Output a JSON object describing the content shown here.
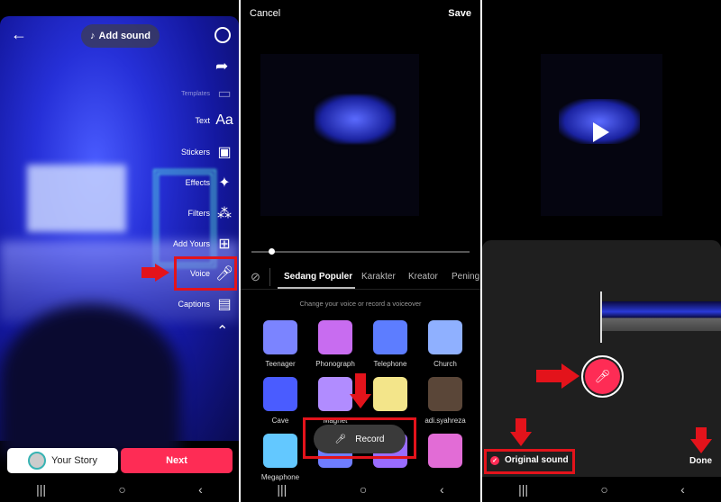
{
  "panel1": {
    "back_icon": "arrow-left",
    "add_sound": "Add sound",
    "tools": [
      {
        "label": "",
        "icon": "settings-gear"
      },
      {
        "label": "",
        "icon": "share-arrow"
      },
      {
        "label": "Templates",
        "icon": "template"
      },
      {
        "label": "Text",
        "icon": "Aa"
      },
      {
        "label": "Stickers",
        "icon": "sticker"
      },
      {
        "label": "Effects",
        "icon": "sparkle"
      },
      {
        "label": "Filters",
        "icon": "filters"
      },
      {
        "label": "Add Yours",
        "icon": "add-yours"
      },
      {
        "label": "Voice",
        "icon": "voice-mic"
      },
      {
        "label": "Captions",
        "icon": "captions"
      },
      {
        "label": "",
        "icon": "chevron-up"
      }
    ],
    "your_story": "Your Story",
    "next": "Next"
  },
  "panel2": {
    "cancel": "Cancel",
    "save": "Save",
    "tabs": [
      "Sedang Populer",
      "Karakter",
      "Kreator",
      "Pening"
    ],
    "subtitle": "Change your voice or record a voiceover",
    "effects": [
      {
        "label": "Teenager",
        "color": "#7b84ff"
      },
      {
        "label": "Phonograph",
        "color": "#c86cf0"
      },
      {
        "label": "Telephone",
        "color": "#5d7dff"
      },
      {
        "label": "Church",
        "color": "#8fb0ff"
      },
      {
        "label": "Cave",
        "color": "#4a5cff"
      },
      {
        "label": "Magnet",
        "color": "#b18cff"
      },
      {
        "label": "",
        "color": "#f3e58a"
      },
      {
        "label": "adi.syahreza",
        "color": "#5a4638"
      },
      {
        "label": "Megaphone",
        "color": "#63c8ff"
      },
      {
        "label": "",
        "color": "#6f7dff"
      },
      {
        "label": "",
        "color": "#9a6cff"
      },
      {
        "label": "",
        "color": "#e26cd6"
      }
    ],
    "record": "Record"
  },
  "panel3": {
    "original_sound": "Original sound",
    "done": "Done"
  },
  "colors": {
    "accent": "#fe2c55",
    "annotation": "#e3131b"
  }
}
